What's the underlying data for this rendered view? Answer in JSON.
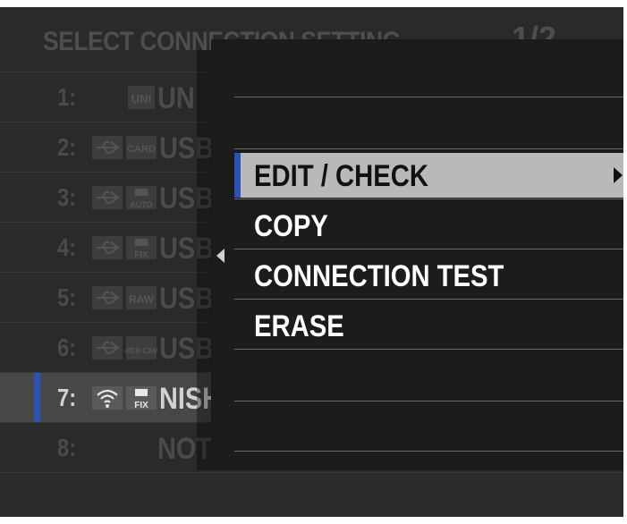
{
  "background": {
    "title": "SELECT CONNECTION SETTING",
    "page": "1/2",
    "rows": [
      {
        "num": "1:",
        "icons": [
          "uni-badge-icon"
        ],
        "badge": "UNI",
        "name": "UN"
      },
      {
        "num": "2:",
        "icons": [
          "usb-icon",
          "card-badge-icon"
        ],
        "badge": "CARD",
        "name": "USB"
      },
      {
        "num": "3:",
        "icons": [
          "usb-icon",
          "camera-auto-icon"
        ],
        "badge": "AUTO",
        "name": "USB"
      },
      {
        "num": "4:",
        "icons": [
          "usb-icon",
          "camera-fix-icon"
        ],
        "badge": "FIX",
        "name": "USB"
      },
      {
        "num": "5:",
        "icons": [
          "usb-icon",
          "raw-badge-icon"
        ],
        "badge": "RAW",
        "name": "USB"
      },
      {
        "num": "6:",
        "icons": [
          "usb-icon",
          "webcam-badge-icon"
        ],
        "badge": "WEB CAM",
        "name": "USB"
      },
      {
        "num": "7:",
        "icons": [
          "wifi-icon",
          "camera-fix-icon"
        ],
        "badge": "FIX",
        "name": "NISH",
        "selected": true
      },
      {
        "num": "8:",
        "icons": [],
        "name": "NOT CREATED"
      }
    ]
  },
  "menu": {
    "items": [
      {
        "label": "EDIT / CHECK",
        "active": true
      },
      {
        "label": "COPY"
      },
      {
        "label": "CONNECTION TEST"
      },
      {
        "label": "ERASE"
      }
    ]
  },
  "colors": {
    "accent": "#2b53b5",
    "highlight": "#b9b9b9",
    "panel": "#1c1c1c",
    "screen": "#2a2a2a"
  }
}
